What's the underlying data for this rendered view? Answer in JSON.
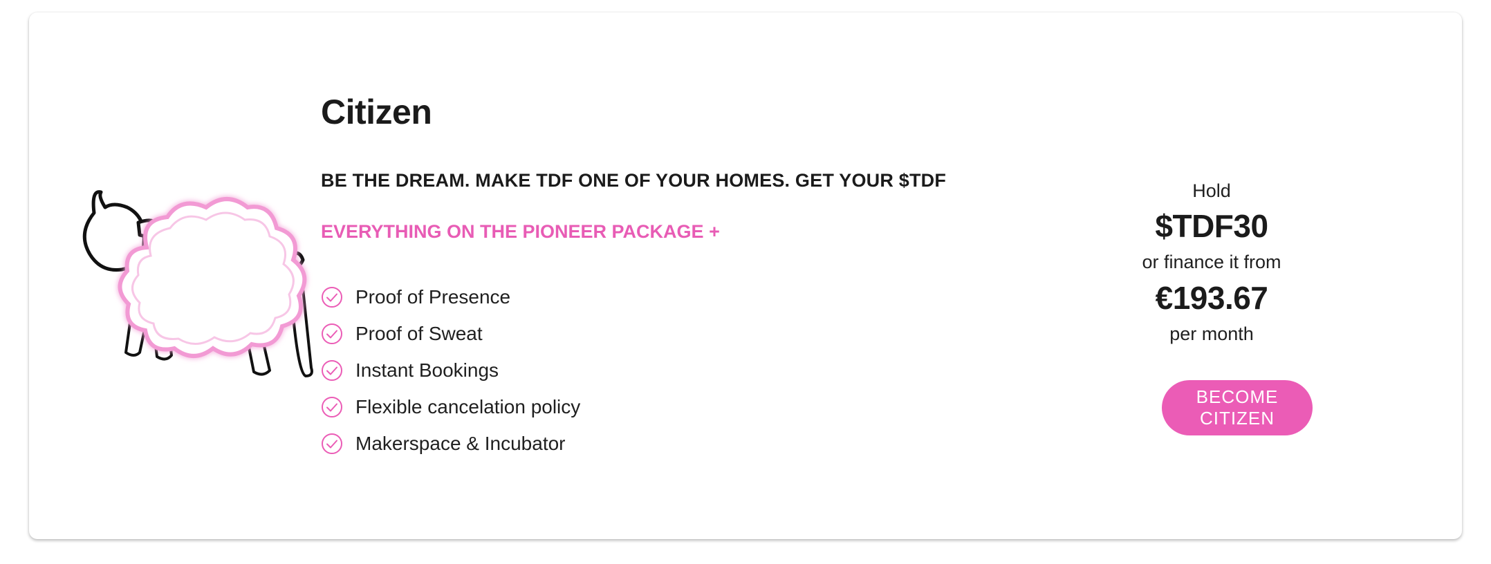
{
  "plan": {
    "title": "Citizen",
    "tagline": "BE THE DREAM. MAKE TDF ONE OF YOUR HOMES. GET YOUR $TDF",
    "package_note": "EVERYTHING ON THE PIONEER PACKAGE +",
    "features": [
      {
        "label": "Proof of Presence",
        "icon": "check-circle-icon"
      },
      {
        "label": "Proof of Sweat",
        "icon": "check-circle-icon"
      },
      {
        "label": "Instant Bookings",
        "icon": "check-circle-icon"
      },
      {
        "label": "Flexible cancelation policy",
        "icon": "check-circle-icon"
      },
      {
        "label": "Makerspace & Incubator",
        "icon": "check-circle-icon"
      }
    ],
    "illustration": "sheep-illustration"
  },
  "pricing": {
    "hold_label": "Hold",
    "token_amount": "$TDF30",
    "finance_label": "or finance it from",
    "monthly_price": "€193.67",
    "period_label": "per month",
    "cta_label": "BECOME CITIZEN"
  },
  "colors": {
    "accent": "#eb5cb6",
    "text": "#1b1b1b",
    "card_bg": "#ffffff"
  }
}
